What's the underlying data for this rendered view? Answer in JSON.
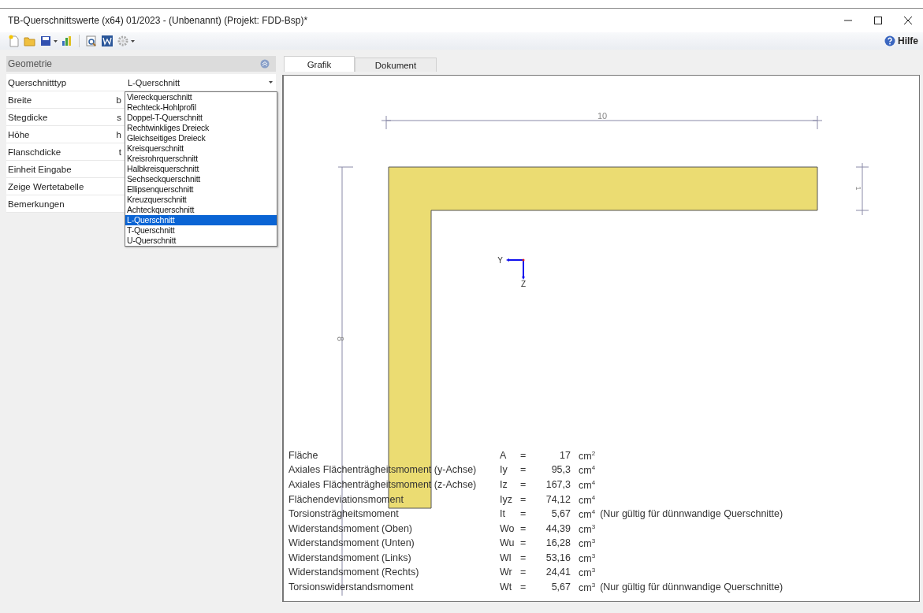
{
  "window": {
    "title": "TB-Querschnittswerte (x64) 01/2023 - (Unbenannt) (Projekt: FDD-Bsp)*"
  },
  "toolbar": {
    "help_label": "Hilfe"
  },
  "property_panel": {
    "header": "Geometrie",
    "rows": [
      {
        "label": "Querschnitttyp",
        "symbol": "",
        "value": "L-Querschnitt",
        "kind": "dropdown"
      },
      {
        "label": "Breite",
        "symbol": "b",
        "kind": "text"
      },
      {
        "label": "Stegdicke",
        "symbol": "s",
        "kind": "text"
      },
      {
        "label": "Höhe",
        "symbol": "h",
        "kind": "text"
      },
      {
        "label": "Flanschdicke",
        "symbol": "t",
        "kind": "text"
      },
      {
        "label": "Einheit Eingabe",
        "symbol": "",
        "kind": "text"
      },
      {
        "label": "Zeige Wertetabelle",
        "symbol": "",
        "kind": "text"
      },
      {
        "label": "Bemerkungen",
        "symbol": "",
        "kind": "text"
      }
    ],
    "dropdown_options": [
      {
        "label": "Viereckquerschnitt",
        "selected": false
      },
      {
        "label": "Rechteck-Hohlprofil",
        "selected": false
      },
      {
        "label": "Doppel-T-Querschnitt",
        "selected": false
      },
      {
        "label": "Rechtwinkliges Dreieck",
        "selected": false
      },
      {
        "label": "Gleichseitiges Dreieck",
        "selected": false
      },
      {
        "label": "Kreisquerschnitt",
        "selected": false
      },
      {
        "label": "Kreisrohrquerschnitt",
        "selected": false
      },
      {
        "label": "Halbkreisquerschnitt",
        "selected": false
      },
      {
        "label": "Sechseckquerschnitt",
        "selected": false
      },
      {
        "label": "Ellipsenquerschnitt",
        "selected": false
      },
      {
        "label": "Kreuzquerschnitt",
        "selected": false
      },
      {
        "label": "Achteckquerschnitt",
        "selected": false
      },
      {
        "label": "L-Querschnitt",
        "selected": true
      },
      {
        "label": "T-Querschnitt",
        "selected": false
      },
      {
        "label": "U-Querschnitt",
        "selected": false
      }
    ]
  },
  "tabs": [
    {
      "label": "Grafik",
      "selected": true
    },
    {
      "label": "Dokument",
      "selected": false
    }
  ],
  "drawing": {
    "width_dimension": "10",
    "height_dimension": "8",
    "thickness_dimension": "1",
    "axis_y": "Y",
    "axis_z": "Z"
  },
  "results": [
    {
      "name": "Fläche",
      "symbol": "A",
      "eq": "=",
      "value": "17",
      "unit": "cm$^{2}$"
    },
    {
      "name": "Axiales Flächenträgheitsmoment (y-Achse)",
      "symbol": "Iy",
      "eq": "=",
      "value": "95,3",
      "unit": "cm$^{4}$"
    },
    {
      "name": "Axiales Flächenträgheitsmoment (z-Achse)",
      "symbol": "Iz",
      "eq": "=",
      "value": "167,3",
      "unit": "cm$^{4}$"
    },
    {
      "name": "Flächendeviationsmoment",
      "symbol": "Iyz",
      "eq": "=",
      "value": "74,12",
      "unit": "cm$^{4}$"
    },
    {
      "name": "Torsionsträgheitsmoment",
      "symbol": "It",
      "eq": "=",
      "value": "5,67",
      "unit": "cm$^{4}$",
      "note": "(Nur gültig für dünnwandige Querschnitte)"
    },
    {
      "name": "Widerstandsmoment (Oben)",
      "symbol": "Wo",
      "eq": "=",
      "value": "44,39",
      "unit": "cm$^{3}$"
    },
    {
      "name": "Widerstandsmoment (Unten)",
      "symbol": "Wu",
      "eq": "=",
      "value": "16,28",
      "unit": "cm$^{3}$"
    },
    {
      "name": "Widerstandsmoment (Links)",
      "symbol": "Wl",
      "eq": "=",
      "value": "53,16",
      "unit": "cm$^{3}$"
    },
    {
      "name": "Widerstandsmoment (Rechts)",
      "symbol": "Wr",
      "eq": "=",
      "value": "24,41",
      "unit": "cm$^{3}$"
    },
    {
      "name": "Torsionswiderstandsmoment",
      "symbol": "Wt",
      "eq": "=",
      "value": "5,67",
      "unit": "cm$^{3}$",
      "note": "(Nur gültig für dünnwandige Querschnitte)"
    }
  ]
}
